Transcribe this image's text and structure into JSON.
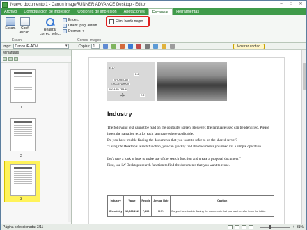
{
  "window": {
    "title": "Nuevo documento 1 - Canon imageRUNNER ADVANCE Desktop - Editor"
  },
  "tabs": [
    {
      "label": "Archivo"
    },
    {
      "label": "Configuración de impresión"
    },
    {
      "label": "Opciones de impresión"
    },
    {
      "label": "Anotaciones"
    },
    {
      "label": "Escanear",
      "active": true
    },
    {
      "label": "Herramientas"
    }
  ],
  "ribbon": {
    "scan_label": "Escan.",
    "config_label": "Conf. escan.",
    "group_scan": "Escan.",
    "search_label": "Realizar correc. selec.",
    "endez_label": "Endez.",
    "orient_label": "Orient. pág. autom.",
    "desmar_label": "Desmar.",
    "elim_label": "Elim. borde negro",
    "group_correct": "Correc. imagen"
  },
  "toolbar2": {
    "printer_label": "Impr.:",
    "printer_value": "Canon iR-ADV",
    "copies_label": "Copias:",
    "copies_value": "1",
    "show_annotations": "Mostrar anotac."
  },
  "thumbnails": {
    "header": "Miniaturas",
    "pages": [
      "1",
      "2",
      "3"
    ]
  },
  "document": {
    "map_labels": [
      "E-10",
      "E-6",
      "SHORE DAY",
      "GRACE WHARF",
      "ABOARD TRAIN",
      "E-2"
    ],
    "heading": "Industry",
    "paragraphs": [
      "The following text cannot be read on the computer screen. However, the language used can be identified. Please insert the narration text for each language where applicable.",
      "Do you have trouble finding the documents that you want to refer to on the shared server?",
      "\"Using iW Desktop's search function, you can quickly find the documents you need via a simple operation.",
      "Let's take a look at how to make use of the search function and create a proposal document.\"",
      "First, use iW Desktop's search function to find the documents that you want to reuse."
    ],
    "table": {
      "headers": [
        "Industry",
        "Value",
        "People",
        "Annual Rate",
        "Caption"
      ],
      "rows": [
        [
          "Chemistry",
          "12,563,212",
          "7,800",
          "115%",
          "Do you have trouble finding the documents that you want to refer to on the folder"
        ]
      ]
    }
  },
  "status": {
    "page_info": "Página seleccionada: 3/11",
    "zoom": "31%",
    "zoom_fraction": 0.31
  }
}
